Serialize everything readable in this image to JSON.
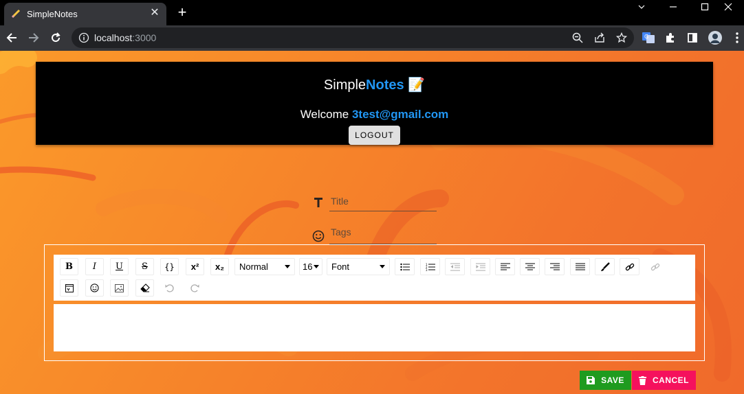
{
  "browser": {
    "tab_title": "SimpleNotes",
    "url_host": "localhost",
    "url_port": ":3000"
  },
  "header": {
    "brand_simple": "Simple",
    "brand_notes": "Notes",
    "brand_emoji": "📝",
    "welcome_text": "Welcome ",
    "user_email": "3test@gmail.com",
    "logout_label": "LOGOUT"
  },
  "form": {
    "title_placeholder": "Title",
    "tags_placeholder": "Tags"
  },
  "editor_toolbar": {
    "bold": "B",
    "italic": "I",
    "underline": "U",
    "strike": "S",
    "code": "{}",
    "superscript": "x²",
    "subscript": "x₂",
    "block_type": "Normal",
    "font_size": "16",
    "font_family": "Font"
  },
  "actions": {
    "save_label": "SAVE",
    "cancel_label": "CANCEL"
  },
  "colors": {
    "accent_blue": "#2196f3",
    "save_green": "#1f9b1f",
    "cancel_pink": "#f5115d",
    "background_orange": "#f7872a"
  }
}
